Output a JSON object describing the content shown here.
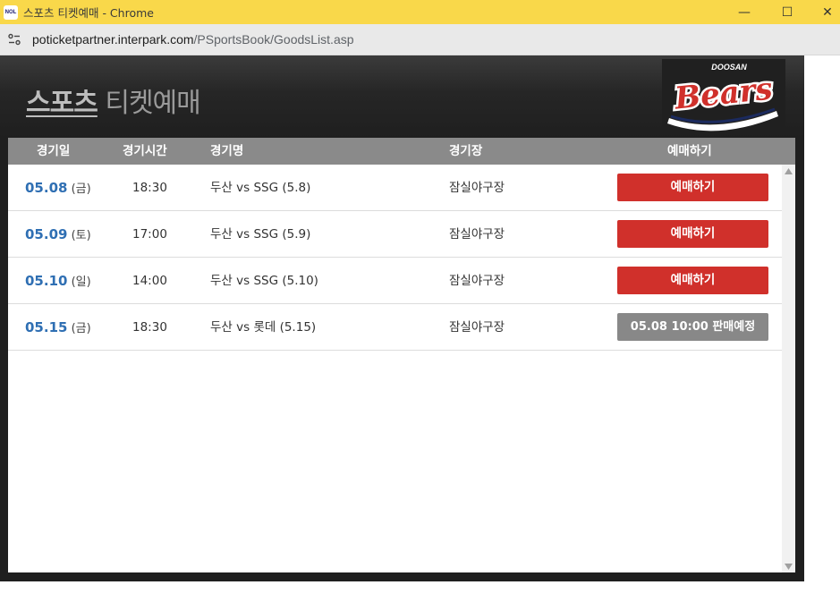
{
  "window": {
    "title": "스포츠 티켓예매 - Chrome",
    "favicon_text": "NOL",
    "controls": {
      "minimize": "—",
      "maximize": "☐",
      "close": "✕"
    }
  },
  "address_bar": {
    "url_host": "poticketpartner.interpark.com",
    "url_path": "/PSportsBook/GoodsList.asp"
  },
  "header": {
    "title_bold": "스포츠",
    "title_rest": " 티켓예매",
    "logo_top": "DOOSAN",
    "logo_main": "Bears"
  },
  "table": {
    "columns": [
      "경기일",
      "경기시간",
      "경기명",
      "경기장",
      "예매하기"
    ],
    "rows": [
      {
        "date": "05.08",
        "dow": " (금)",
        "time": "18:30",
        "match": "두산 vs SSG (5.8)",
        "venue": "잠실야구장",
        "action": "예매하기",
        "status": "open"
      },
      {
        "date": "05.09",
        "dow": " (토)",
        "time": "17:00",
        "match": "두산 vs SSG (5.9)",
        "venue": "잠실야구장",
        "action": "예매하기",
        "status": "open"
      },
      {
        "date": "05.10",
        "dow": " (일)",
        "time": "14:00",
        "match": "두산 vs SSG (5.10)",
        "venue": "잠실야구장",
        "action": "예매하기",
        "status": "open"
      },
      {
        "date": "05.15",
        "dow": " (금)",
        "time": "18:30",
        "match": "두산 vs 롯데 (5.15)",
        "venue": "잠실야구장",
        "action": "05.08 10:00 판매예정",
        "status": "scheduled"
      }
    ]
  },
  "colors": {
    "titlebar": "#f9d84a",
    "accent_red": "#d0302b",
    "date_blue": "#2f6fb3",
    "header_gray": "#8a8a8a",
    "logo_navy": "#1b2a5e",
    "logo_red": "#d0302b"
  }
}
